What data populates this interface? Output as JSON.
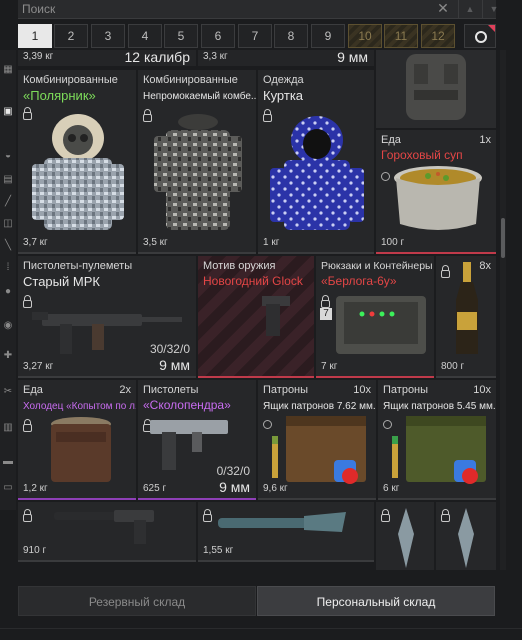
{
  "search": {
    "placeholder": "Поиск"
  },
  "pages": [
    "1",
    "2",
    "3",
    "4",
    "5",
    "6",
    "7",
    "8",
    "9",
    "10",
    "11",
    "12"
  ],
  "active_page": "1",
  "top_row": [
    {
      "weight": "3,39 кг",
      "caliber": "12 калибр"
    },
    {
      "weight": "3,3 кг",
      "caliber": "9 мм"
    }
  ],
  "items": [
    {
      "category": "Комбинированные",
      "name": "«Полярник»",
      "weight": "3,7 кг"
    },
    {
      "category": "Комбинированные",
      "name": "Непромокаемый комбе...",
      "weight": "3,5 кг"
    },
    {
      "category": "Одежда",
      "name": "Куртка",
      "weight": "1 кг"
    },
    {
      "category": "Еда",
      "qty": "1x",
      "name": "Гороховый суп",
      "weight": "100 г"
    },
    {
      "category": "Пистолеты-пулеметы",
      "name": "Старый МРК",
      "weight": "3,27 кг",
      "ammo": "30/32/0",
      "caliber": "9 мм"
    },
    {
      "category": "Мотив оружия",
      "name": "Новогодний Glock"
    },
    {
      "category": "Рюкзаки и Контейнеры",
      "name": "«Берлога-6у»",
      "weight": "7 кг",
      "slots": "7"
    },
    {
      "qty": "8x",
      "weight": "800 г"
    },
    {
      "category": "Еда",
      "qty": "2x",
      "name": "Холодец «Копытом по л...",
      "weight": "1,2 кг"
    },
    {
      "category": "Пистолеты",
      "name": "«Сколопендра»",
      "weight": "625 г",
      "ammo": "0/32/0",
      "caliber": "9 мм"
    },
    {
      "category": "Патроны",
      "qty": "10x",
      "name": "Ящик патронов 7.62 мм...",
      "weight": "9,6 кг"
    },
    {
      "category": "Патроны",
      "qty": "10x",
      "name": "Ящик патронов 5.45 мм...",
      "weight": "6 кг"
    },
    {
      "weight": "910 г"
    },
    {
      "weight": "1,55 кг"
    }
  ],
  "bottom_tabs": {
    "reserve": "Резервный склад",
    "personal": "Персональный склад"
  },
  "colors": {
    "accent_green": "#7ddc5a",
    "accent_red": "#e34646",
    "accent_purple": "#c86cf0",
    "rarity_red": "#c03a4a",
    "rarity_purple": "#8e3fb6"
  }
}
